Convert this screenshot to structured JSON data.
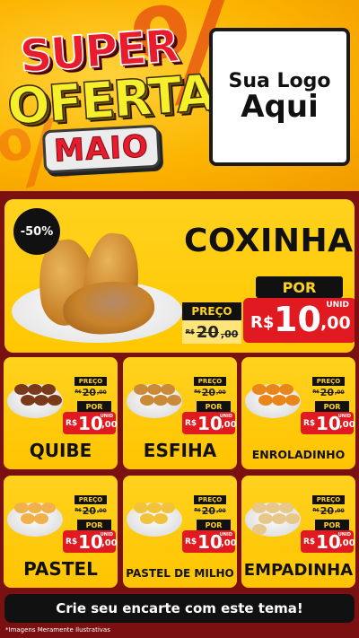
{
  "header": {
    "title_super": "SUPER",
    "title_ofertas": "OFERTAS",
    "title_month": "MAIO",
    "percent_glyph": "%",
    "logo_line1": "Sua Logo",
    "logo_line2": "Aqui"
  },
  "featured": {
    "discount_badge": "-50%",
    "name": "COXINHA",
    "old_label": "PREÇO",
    "old_currency": "R$",
    "old_int": "20",
    "old_dec": ",00",
    "new_label": "POR",
    "new_currency": "R$",
    "new_int": "10",
    "new_dec": ",00",
    "unit": "UNID"
  },
  "products": [
    {
      "name": "QUIBE",
      "old_label": "PREÇO",
      "old_currency": "R$",
      "old_int": "20",
      "old_dec": ",00",
      "new_label": "POR",
      "new_currency": "R$",
      "new_int": "10",
      "new_dec": ",00",
      "unit": "UNID"
    },
    {
      "name": "ESFIHA",
      "old_label": "PREÇO",
      "old_currency": "R$",
      "old_int": "20",
      "old_dec": ",00",
      "new_label": "POR",
      "new_currency": "R$",
      "new_int": "10",
      "new_dec": ",00",
      "unit": "UNID"
    },
    {
      "name": "ENROLADINHO",
      "old_label": "PREÇO",
      "old_currency": "R$",
      "old_int": "20",
      "old_dec": ",00",
      "new_label": "POR",
      "new_currency": "R$",
      "new_int": "10",
      "new_dec": ",00",
      "unit": "UNID"
    },
    {
      "name": "PASTEL",
      "old_label": "PREÇO",
      "old_currency": "R$",
      "old_int": "20",
      "old_dec": ",00",
      "new_label": "POR",
      "new_currency": "R$",
      "new_int": "10",
      "new_dec": ",00",
      "unit": "UNID"
    },
    {
      "name": "PASTEL DE MILHO",
      "old_label": "PREÇO",
      "old_currency": "R$",
      "old_int": "20",
      "old_dec": ",00",
      "new_label": "POR",
      "new_currency": "R$",
      "new_int": "10",
      "new_dec": ",00",
      "unit": "UNID"
    },
    {
      "name": "EMPADINHA",
      "old_label": "PREÇO",
      "old_currency": "R$",
      "old_int": "20",
      "old_dec": ",00",
      "new_label": "POR",
      "new_currency": "R$",
      "new_int": "10",
      "new_dec": ",00",
      "unit": "UNID"
    }
  ],
  "footer": {
    "cta_text": "Crie seu encarte com este tema!",
    "disclaimer": "*Imagens Meramente Ilustrativas"
  },
  "colors": {
    "background": "#7a1010",
    "card_yellow": "#ffc800",
    "price_red": "#e01a20",
    "tag_black": "#111111"
  }
}
